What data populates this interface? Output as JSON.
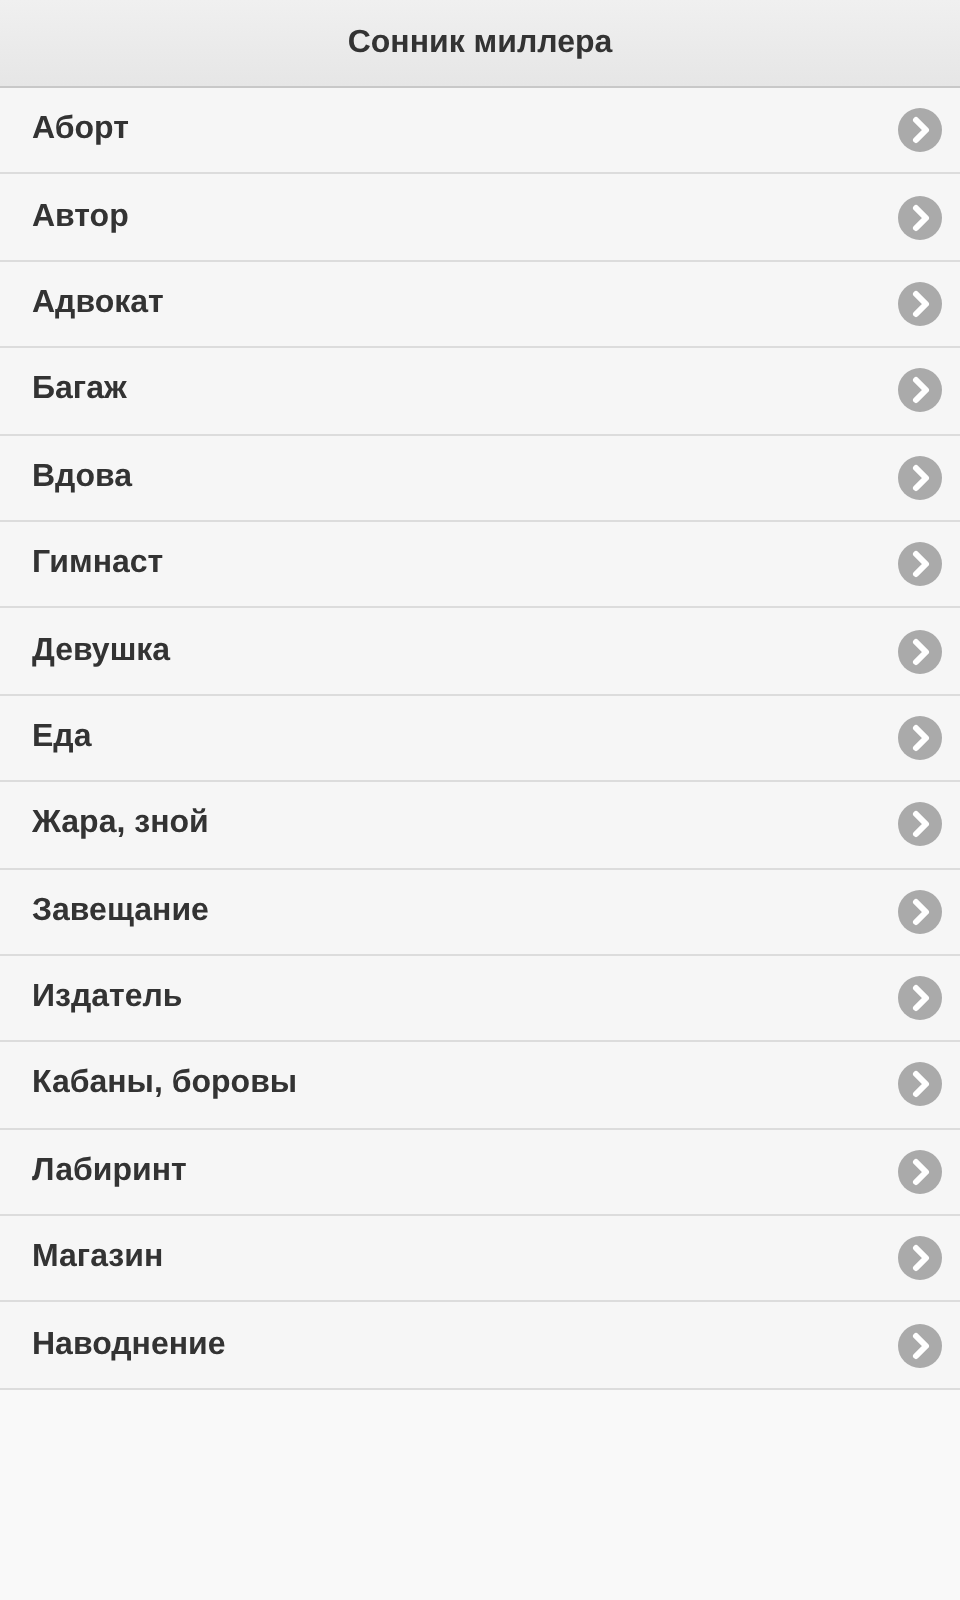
{
  "header": {
    "title": "Сонник миллера"
  },
  "items": [
    {
      "label": "Аборт"
    },
    {
      "label": "Автор"
    },
    {
      "label": "Адвокат"
    },
    {
      "label": "Багаж"
    },
    {
      "label": "Вдова"
    },
    {
      "label": "Гимнаст"
    },
    {
      "label": "Девушка"
    },
    {
      "label": "Еда"
    },
    {
      "label": "Жара, зной"
    },
    {
      "label": "Завещание"
    },
    {
      "label": "Издатель"
    },
    {
      "label": "Кабаны, боровы"
    },
    {
      "label": "Лабиринт"
    },
    {
      "label": "Магазин"
    },
    {
      "label": "Наводнение"
    }
  ]
}
